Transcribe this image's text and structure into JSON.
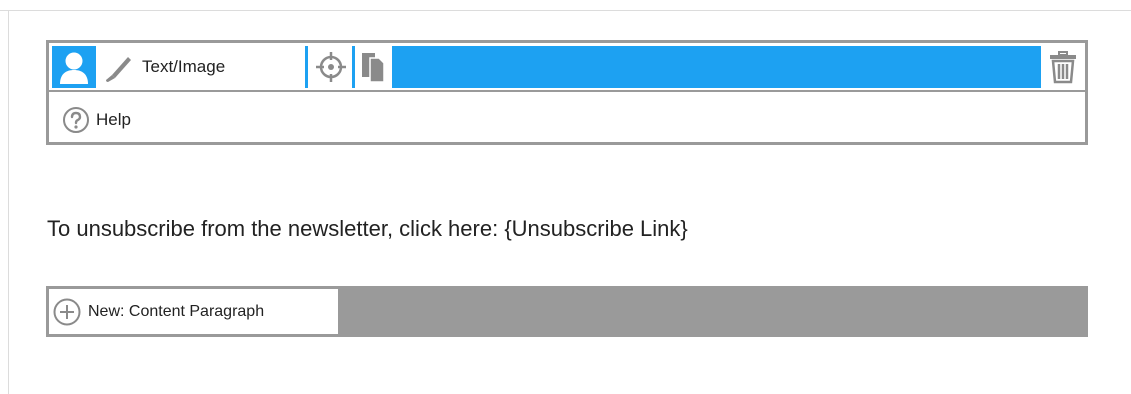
{
  "colors": {
    "accent": "#1da1f2",
    "border_gray": "#9a9a9a",
    "icon_gray": "#8a8a8a",
    "text": "#222222"
  },
  "toolbar": {
    "user_icon": "user-icon",
    "edit_icon": "pencil-icon",
    "edit_label": "Text/Image",
    "target_icon": "crosshair-icon",
    "copy_icon": "copy-icon",
    "delete_icon": "trash-icon"
  },
  "help": {
    "icon": "question-circle-icon",
    "label": "Help"
  },
  "content": {
    "paragraph": "To unsubscribe from the newsletter, click here: {Unsubscribe Link}"
  },
  "new_paragraph": {
    "icon": "plus-circle-icon",
    "label": "New: Content Paragraph"
  }
}
